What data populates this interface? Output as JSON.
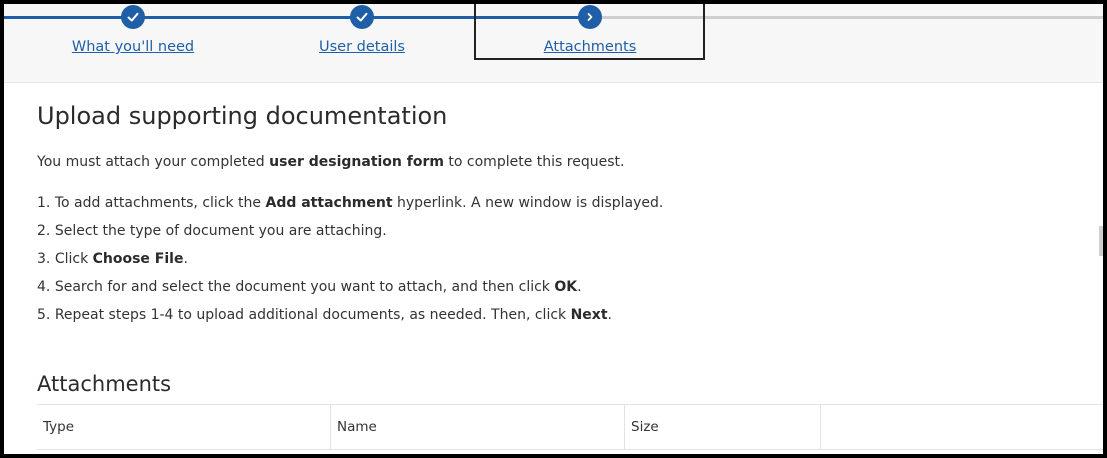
{
  "stepper": {
    "steps": [
      {
        "label": "What you'll need",
        "status": "complete",
        "icon": "check-icon"
      },
      {
        "label": "User details",
        "status": "complete",
        "icon": "check-icon"
      },
      {
        "label": "Attachments",
        "status": "current",
        "icon": "chevron-right-icon"
      }
    ],
    "colors": {
      "accent": "#1f5fa8",
      "inactive_track": "#cfcfcf"
    }
  },
  "main": {
    "title": "Upload supporting documentation",
    "intro": {
      "before": "You must attach your completed ",
      "bold": "user designation form",
      "after": " to complete this request."
    },
    "steps": [
      {
        "num": "1.",
        "before": "To add attachments, click the ",
        "bold": "Add attachment",
        "after": " hyperlink. A new window is displayed."
      },
      {
        "num": "2.",
        "before": "Select the type of document you are attaching.",
        "bold": "",
        "after": ""
      },
      {
        "num": "3.",
        "before": "Click ",
        "bold": "Choose File",
        "after": "."
      },
      {
        "num": "4.",
        "before": "Search for and select the document you want to attach, and then click ",
        "bold": "OK",
        "after": "."
      },
      {
        "num": "5.",
        "before": "Repeat steps 1-4 to upload additional documents, as needed. Then, click ",
        "bold": "Next",
        "after": "."
      }
    ]
  },
  "attachments": {
    "title": "Attachments",
    "columns": [
      "Type",
      "Name",
      "Size",
      ""
    ]
  }
}
